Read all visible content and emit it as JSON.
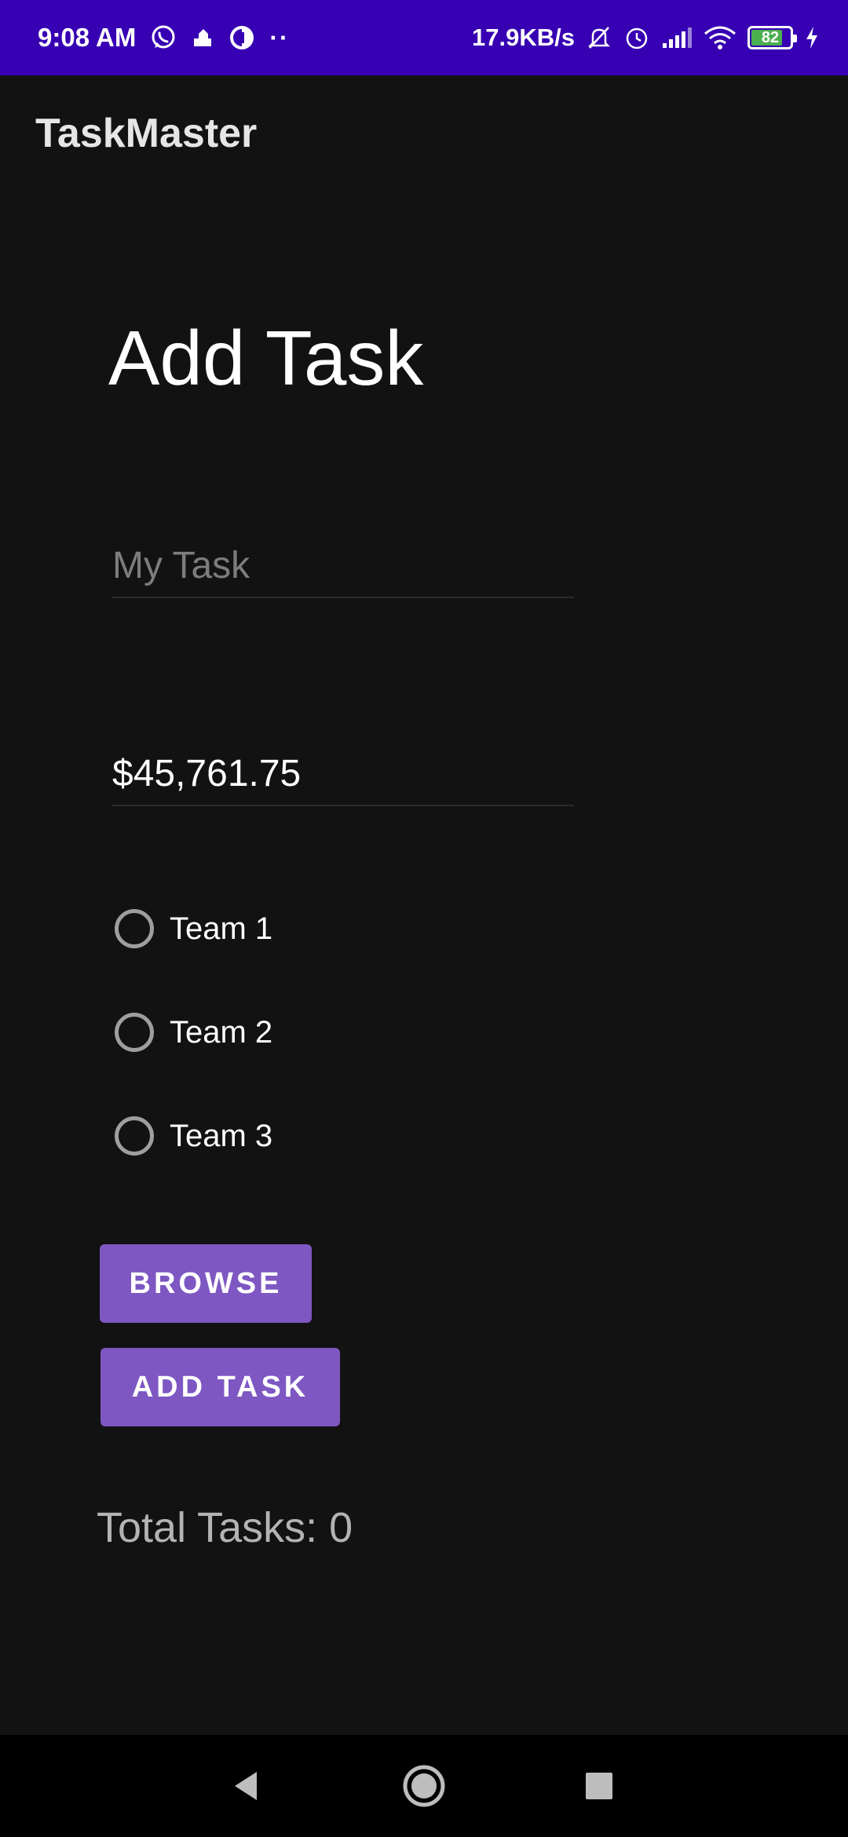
{
  "status_bar": {
    "time": "9:08 AM",
    "net_speed": "17.9KB/s",
    "battery_level": "82",
    "battery_fraction": 0.82,
    "more_dots": "··",
    "background_color": "#3700b3",
    "left_icons": [
      "whatsapp-icon",
      "notification-app-icon",
      "circle-app-icon"
    ],
    "right_icons": [
      "bell-muted-icon",
      "alarm-icon",
      "signal-icon",
      "wifi-icon",
      "battery-icon",
      "charging-icon"
    ]
  },
  "app_bar": {
    "title": "TaskMaster"
  },
  "main": {
    "heading": "Add Task",
    "task_title_input": {
      "value": "",
      "placeholder": "My Task"
    },
    "amount_input": {
      "value": "$45,761.75",
      "placeholder": ""
    },
    "team_options": [
      {
        "label": "Team 1",
        "selected": false
      },
      {
        "label": "Team 2",
        "selected": false
      },
      {
        "label": "Team 3",
        "selected": false
      }
    ],
    "browse_button": "BROWSE",
    "add_task_button": "ADD TASK",
    "total_tasks": "Total Tasks: 0",
    "accent_color": "#7e57c2"
  },
  "nav_bar": {
    "buttons": [
      "back-icon",
      "home-icon",
      "recents-icon"
    ]
  }
}
